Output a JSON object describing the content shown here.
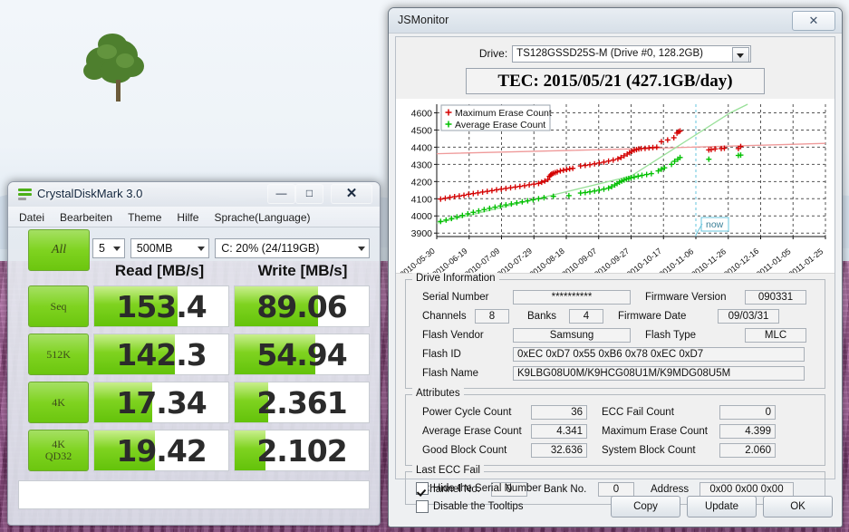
{
  "desktop": {
    "wallpaper_name": "lavender-field-with-lone-tree"
  },
  "crystaldiskmark": {
    "title": "CrystalDiskMark 3.0",
    "icon": "crystaldiskmark-icon",
    "window_buttons": {
      "minimize": "—",
      "maximize": "□",
      "close": "✕"
    },
    "menu": [
      "Datei",
      "Bearbeiten",
      "Theme",
      "Hilfe",
      "Sprache(Language)"
    ],
    "controls": {
      "all_button": "All",
      "runs": "5",
      "size": "500MB",
      "drive": "C: 20% (24/119GB)"
    },
    "headers": {
      "read": "Read [MB/s]",
      "write": "Write [MB/s]"
    },
    "rows": [
      {
        "label": "Seq",
        "label2": "",
        "read": "153.4",
        "write": "89.06",
        "read_fill": 62,
        "write_fill": 62
      },
      {
        "label": "512K",
        "label2": "",
        "read": "142.3",
        "write": "54.94",
        "read_fill": 60,
        "write_fill": 60
      },
      {
        "label": "4K",
        "label2": "",
        "read": "17.34",
        "write": "2.361",
        "read_fill": 43,
        "write_fill": 25
      },
      {
        "label": "4K",
        "label2": "QD32",
        "read": "19.42",
        "write": "2.102",
        "read_fill": 45,
        "write_fill": 23
      }
    ],
    "status": ""
  },
  "jsmonitor": {
    "title": "JSMonitor",
    "close_label": "✕",
    "drive_label": "Drive:",
    "drive_value": "TS128GSSD25S-M (Drive #0, 128.2GB)",
    "tec": "TEC: 2015/05/21 (427.1GB/day)",
    "drive_information": {
      "caption": "Drive Information",
      "serial_number_label": "Serial Number",
      "serial_number_value": "**********",
      "firmware_version_label": "Firmware Version",
      "firmware_version_value": "090331",
      "channels_label": "Channels",
      "channels_value": "8",
      "banks_label": "Banks",
      "banks_value": "4",
      "firmware_date_label": "Firmware Date",
      "firmware_date_value": "09/03/31",
      "flash_vendor_label": "Flash Vendor",
      "flash_vendor_value": "Samsung",
      "flash_type_label": "Flash Type",
      "flash_type_value": "MLC",
      "flash_id_label": "Flash ID",
      "flash_id_value": "0xEC 0xD7 0x55 0xB6 0x78 0xEC 0xD7",
      "flash_name_label": "Flash Name",
      "flash_name_value": "K9LBG08U0M/K9HCG08U1M/K9MDG08U5M"
    },
    "attributes": {
      "caption": "Attributes",
      "power_cycle_count_label": "Power Cycle Count",
      "power_cycle_count_value": "36",
      "ecc_fail_count_label": "ECC Fail Count",
      "ecc_fail_count_value": "0",
      "average_erase_count_label": "Average Erase Count",
      "average_erase_count_value": "4.341",
      "maximum_erase_count_label": "Maximum Erase Count",
      "maximum_erase_count_value": "4.399",
      "good_block_count_label": "Good Block Count",
      "good_block_count_value": "32.636",
      "system_block_count_label": "System Block Count",
      "system_block_count_value": "2.060"
    },
    "last_ecc_fail": {
      "caption": "Last ECC Fail",
      "channel_no_label": "Channel No.",
      "channel_no_value": "0",
      "bank_no_label": "Bank No.",
      "bank_no_value": "0",
      "address_label": "Address",
      "address_value": "0x00 0x00 0x00"
    },
    "options": {
      "hide_serial_label": "Hide the Serial Number",
      "hide_serial_checked": true,
      "disable_tooltips_label": "Disable the Tooltips",
      "disable_tooltips_checked": false
    },
    "buttons": {
      "copy": "Copy",
      "update": "Update",
      "ok": "OK"
    }
  },
  "chart_data": {
    "type": "scatter",
    "title": "TEC: 2015/05/21 (427.1GB/day)",
    "xlabel": "",
    "ylabel": "",
    "ylim": [
      3880,
      4650
    ],
    "yticks": [
      3900,
      4000,
      4100,
      4200,
      4300,
      4400,
      4500,
      4600
    ],
    "xticks": [
      "2010-05-30",
      "2010-06-19",
      "2010-07-09",
      "2010-07-29",
      "2010-08-18",
      "2010-09-07",
      "2010-09-27",
      "2010-10-17",
      "2010-11-06",
      "2010-11-26",
      "2010-12-16",
      "2011-01-05",
      "2011-01-25"
    ],
    "grid": true,
    "legend_position": "top-left",
    "colors": {
      "maximum": "#d40000",
      "average": "#00c000",
      "now_marker": "#66c4dc"
    },
    "annotations": [
      {
        "text": "now",
        "x": "2010-11-06"
      }
    ],
    "series": [
      {
        "name": "Maximum Erase Count",
        "marker": "+",
        "color": "#d40000",
        "points": [
          [
            0.01,
            4098
          ],
          [
            0.022,
            4103
          ],
          [
            0.034,
            4108
          ],
          [
            0.046,
            4112
          ],
          [
            0.058,
            4116
          ],
          [
            0.07,
            4120
          ],
          [
            0.082,
            4126
          ],
          [
            0.094,
            4130
          ],
          [
            0.106,
            4134
          ],
          [
            0.118,
            4139
          ],
          [
            0.13,
            4143
          ],
          [
            0.142,
            4147
          ],
          [
            0.154,
            4152
          ],
          [
            0.166,
            4156
          ],
          [
            0.178,
            4160
          ],
          [
            0.19,
            4164
          ],
          [
            0.202,
            4168
          ],
          [
            0.214,
            4172
          ],
          [
            0.226,
            4176
          ],
          [
            0.238,
            4181
          ],
          [
            0.25,
            4185
          ],
          [
            0.262,
            4189
          ],
          [
            0.27,
            4196
          ],
          [
            0.278,
            4203
          ],
          [
            0.286,
            4212
          ],
          [
            0.29,
            4230
          ],
          [
            0.293,
            4238
          ],
          [
            0.296,
            4244
          ],
          [
            0.3,
            4248
          ],
          [
            0.305,
            4252
          ],
          [
            0.31,
            4256
          ],
          [
            0.318,
            4262
          ],
          [
            0.326,
            4266
          ],
          [
            0.334,
            4270
          ],
          [
            0.342,
            4274
          ],
          [
            0.35,
            4277
          ],
          [
            0.37,
            4291
          ],
          [
            0.382,
            4294
          ],
          [
            0.394,
            4298
          ],
          [
            0.406,
            4303
          ],
          [
            0.418,
            4308
          ],
          [
            0.43,
            4313
          ],
          [
            0.442,
            4319
          ],
          [
            0.454,
            4325
          ],
          [
            0.466,
            4332
          ],
          [
            0.474,
            4340
          ],
          [
            0.482,
            4350
          ],
          [
            0.49,
            4360
          ],
          [
            0.496,
            4368
          ],
          [
            0.502,
            4376
          ],
          [
            0.508,
            4382
          ],
          [
            0.514,
            4386
          ],
          [
            0.52,
            4390
          ],
          [
            0.526,
            4392
          ],
          [
            0.536,
            4393
          ],
          [
            0.546,
            4396
          ],
          [
            0.556,
            4398
          ],
          [
            0.566,
            4400
          ],
          [
            0.578,
            4432
          ],
          [
            0.594,
            4442
          ],
          [
            0.61,
            4455
          ],
          [
            0.618,
            4482
          ],
          [
            0.622,
            4490
          ],
          [
            0.626,
            4494
          ],
          [
            0.7,
            4384
          ],
          [
            0.706,
            4386
          ],
          [
            0.716,
            4390
          ],
          [
            0.732,
            4392
          ],
          [
            0.74,
            4394
          ],
          [
            0.776,
            4392
          ],
          [
            0.782,
            4404
          ]
        ]
      },
      {
        "name": "Average Erase Count",
        "marker": "+",
        "color": "#00c000",
        "points": [
          [
            0.01,
            3968
          ],
          [
            0.024,
            3976
          ],
          [
            0.038,
            3985
          ],
          [
            0.052,
            3994
          ],
          [
            0.066,
            4003
          ],
          [
            0.08,
            4012
          ],
          [
            0.094,
            4021
          ],
          [
            0.108,
            4029
          ],
          [
            0.122,
            4037
          ],
          [
            0.136,
            4044
          ],
          [
            0.15,
            4051
          ],
          [
            0.164,
            4058
          ],
          [
            0.178,
            4064
          ],
          [
            0.192,
            4070
          ],
          [
            0.206,
            4076
          ],
          [
            0.22,
            4082
          ],
          [
            0.234,
            4088
          ],
          [
            0.248,
            4094
          ],
          [
            0.262,
            4100
          ],
          [
            0.276,
            4106
          ],
          [
            0.3,
            4114
          ],
          [
            0.34,
            4118
          ],
          [
            0.37,
            4133
          ],
          [
            0.382,
            4136
          ],
          [
            0.394,
            4140
          ],
          [
            0.406,
            4145
          ],
          [
            0.418,
            4150
          ],
          [
            0.43,
            4156
          ],
          [
            0.442,
            4162
          ],
          [
            0.45,
            4170
          ],
          [
            0.458,
            4180
          ],
          [
            0.464,
            4188
          ],
          [
            0.47,
            4196
          ],
          [
            0.476,
            4203
          ],
          [
            0.482,
            4209
          ],
          [
            0.488,
            4214
          ],
          [
            0.494,
            4218
          ],
          [
            0.5,
            4222
          ],
          [
            0.508,
            4226
          ],
          [
            0.518,
            4231
          ],
          [
            0.528,
            4236
          ],
          [
            0.54,
            4241
          ],
          [
            0.552,
            4246
          ],
          [
            0.57,
            4262
          ],
          [
            0.578,
            4272
          ],
          [
            0.586,
            4280
          ],
          [
            0.604,
            4300
          ],
          [
            0.612,
            4318
          ],
          [
            0.62,
            4330
          ],
          [
            0.626,
            4340
          ],
          [
            0.7,
            4330
          ],
          [
            0.776,
            4352
          ],
          [
            0.782,
            4354
          ]
        ]
      },
      {
        "name": "Maximum trend",
        "type": "line",
        "color": "#ef9a9a",
        "points": [
          [
            0.0,
            4362
          ],
          [
            0.5,
            4390
          ],
          [
            1.0,
            4422
          ]
        ]
      },
      {
        "name": "Average trend",
        "type": "line",
        "color": "#99e099",
        "points": [
          [
            0.0,
            3958
          ],
          [
            0.5,
            4232
          ],
          [
            0.755,
            4600
          ],
          [
            0.8,
            4650
          ]
        ]
      }
    ]
  }
}
